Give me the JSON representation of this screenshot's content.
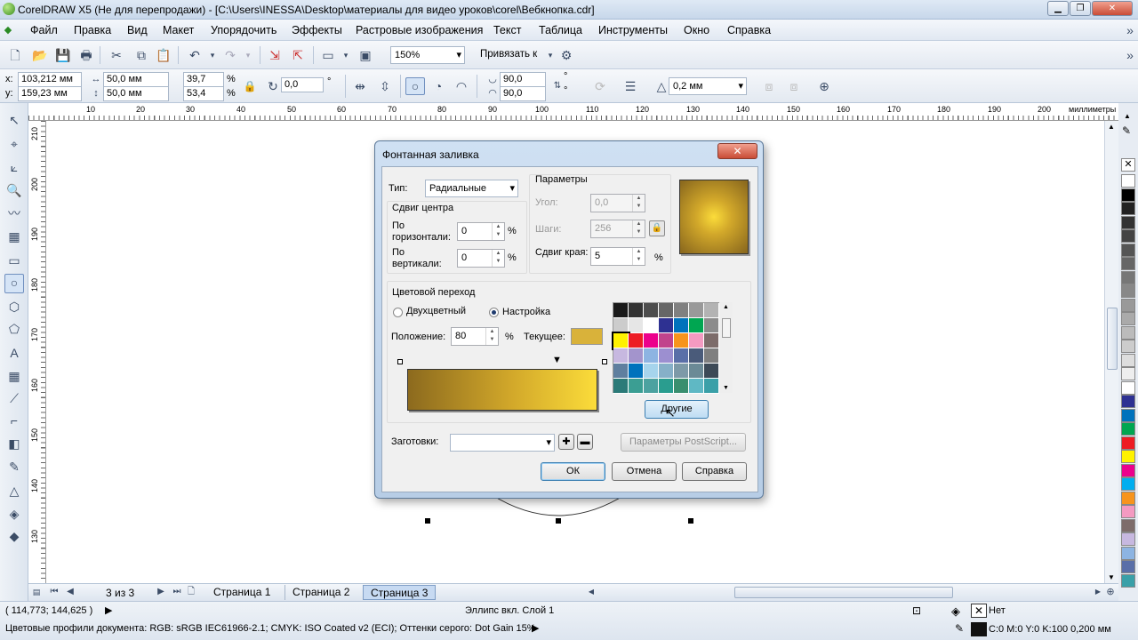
{
  "window": {
    "title": "CorelDRAW X5 (Не для перепродажи) - [C:\\Users\\INESSA\\Desktop\\материалы для видео уроков\\corel\\Вебкнопка.cdr]"
  },
  "menu": [
    "Файл",
    "Правка",
    "Вид",
    "Макет",
    "Упорядочить",
    "Эффекты",
    "Растровые изображения",
    "Текст",
    "Таблица",
    "Инструменты",
    "Окно",
    "Справка"
  ],
  "toolbar": {
    "zoom": "150%",
    "snap": "Привязать к"
  },
  "props": {
    "x_label": "x:",
    "x": "103,212 мм",
    "y_label": "y:",
    "y": "159,23 мм",
    "w": "50,0 мм",
    "h": "50,0 мм",
    "sx": "39,7",
    "sy": "53,4",
    "pct": "%",
    "pct2": "%",
    "rot": "0,0",
    "deg": "°",
    "a1": "90,0",
    "a2": "90,0",
    "deg2": "°",
    "deg3": "°",
    "outline": "0,2 мм"
  },
  "ruler": {
    "unit": "миллиметры",
    "top": [
      "10",
      "20",
      "30",
      "40",
      "50",
      "60",
      "70",
      "80",
      "90",
      "100",
      "110",
      "120",
      "130",
      "140",
      "150",
      "160",
      "170",
      "180",
      "190",
      "200"
    ],
    "left": [
      "210",
      "200",
      "190",
      "180",
      "170",
      "160",
      "150",
      "140",
      "130"
    ]
  },
  "pages": {
    "counter": "3 из 3",
    "tabs": [
      "Страница 1",
      "Страница 2",
      "Страница 3"
    ]
  },
  "status": {
    "coords": "( 114,773; 144,625 )",
    "object": "Эллипс вкл. Слой 1",
    "profiles": "Цветовые профили документа: RGB: sRGB IEC61966-2.1; CMYK: ISO Coated v2 (ECI); Оттенки серого: Dot Gain 15%",
    "fill": "Нет",
    "outline": "C:0 M:0 Y:0 K:100  0,200 мм"
  },
  "dialog": {
    "title": "Фонтанная заливка",
    "close": "✕",
    "type_label": "Тип:",
    "type_value": "Радиальные",
    "center_group": "Сдвиг центра",
    "horiz_label": "По горизонтали:",
    "horiz_value": "0",
    "vert_label": "По вертикали:",
    "vert_value": "0",
    "params_group": "Параметры",
    "angle_label": "Угол:",
    "angle_value": "0,0",
    "steps_label": "Шаги:",
    "steps_value": "256",
    "edge_label": "Сдвиг края:",
    "edge_value": "5",
    "blend_group": "Цветовой переход",
    "two_color": "Двухцветный",
    "custom": "Настройка",
    "position_label": "Положение:",
    "position_value": "80",
    "current_label": "Текущее:",
    "others_btn": "Другие",
    "presets_label": "Заготовки:",
    "postscript_btn": "Параметры PostScript...",
    "ok": "ОК",
    "cancel": "Отмена",
    "help": "Справка"
  },
  "colors": {
    "grad_dark": "#8c6a1e",
    "grad_mid": "#d2a82a",
    "grad_light": "#fbdc3a",
    "current": "#d9b23a",
    "grid": [
      "#1a1a1a",
      "#333333",
      "#4d4d4d",
      "#666666",
      "#808080",
      "#999999",
      "#b3b3b3",
      "#cccccc",
      "#e6e6e6",
      "#ffffff",
      "#2e3192",
      "#0072bc",
      "#00a651",
      "#8c8c8c",
      "#fff200",
      "#ed1c24",
      "#ec008c",
      "#c1448c",
      "#f7941d",
      "#f49ac1",
      "#7d6c6a",
      "#c7b8e0",
      "#a394cc",
      "#8db4e2",
      "#9c8fd0",
      "#5a6fa8",
      "#4a5b7a",
      "#7f7f7f",
      "#5f7f9f",
      "#0072bc",
      "#a6d4ec",
      "#86b0c8",
      "#7d9aa8",
      "#6b8a96",
      "#3d4a57",
      "#2b7a78",
      "#3b9e93",
      "#4ca2a0",
      "#2a9d8f",
      "#3a8f6f",
      "#5fb8c4",
      "#3aa0a8"
    ],
    "palette": [
      "#ffffff",
      "#000000",
      "#222222",
      "#333333",
      "#444444",
      "#555555",
      "#666666",
      "#777777",
      "#888888",
      "#999999",
      "#aaaaaa",
      "#bbbbbb",
      "#cccccc",
      "#dddddd",
      "#eeeeee",
      "#ffffff",
      "#2e3192",
      "#0072bc",
      "#00a651",
      "#ed1c24",
      "#fff200",
      "#ec008c",
      "#00aeef",
      "#f7941d",
      "#f49ac1",
      "#7d6c6a",
      "#c7b8e0",
      "#8db4e2",
      "#5a6fa8",
      "#3aa0a8"
    ]
  }
}
